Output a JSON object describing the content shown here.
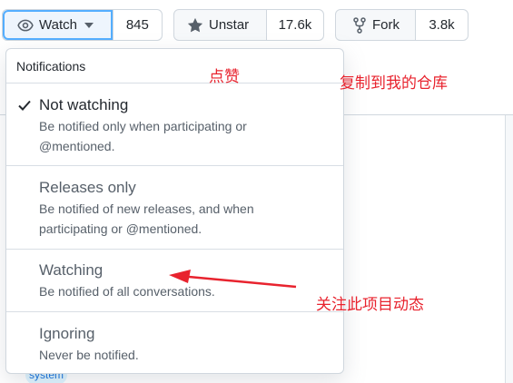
{
  "actions": {
    "watch": {
      "label": "Watch",
      "count": "845"
    },
    "star": {
      "label": "Unstar",
      "count": "17.6k"
    },
    "fork": {
      "label": "Fork",
      "count": "3.8k"
    }
  },
  "dropdown": {
    "header": "Notifications",
    "options": [
      {
        "title": "Not watching",
        "desc_line1": "Be notified only when participating or",
        "desc_line2": "@mentioned.",
        "selected": true
      },
      {
        "title": "Releases only",
        "desc_line1": "Be notified of new releases, and when",
        "desc_line2": "participating or @mentioned.",
        "selected": false
      },
      {
        "title": "Watching",
        "desc_line1": "Be notified of all conversations.",
        "selected": false
      },
      {
        "title": "Ignoring",
        "desc_line1": "Never be notified.",
        "selected": false
      }
    ]
  },
  "annotations": {
    "star_note": "点赞",
    "fork_note": "复制到我的仓库",
    "watch_note": "关注此项目动态"
  },
  "background": {
    "topic_tag": "system"
  },
  "colors": {
    "annotation_red": "#e8232e",
    "focus_blue": "#54aeff",
    "border": "#d0d7de"
  }
}
